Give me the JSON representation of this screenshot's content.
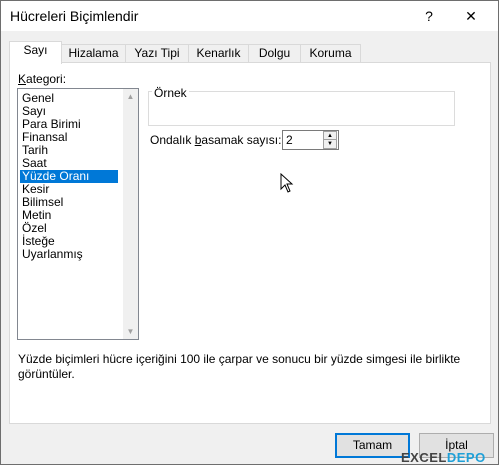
{
  "window": {
    "title": "Hücreleri Biçimlendir",
    "help_glyph": "?",
    "close_glyph": "✕"
  },
  "tabs": [
    {
      "label": "Sayı"
    },
    {
      "label": "Hizalama"
    },
    {
      "label": "Yazı Tipi"
    },
    {
      "label": "Kenarlık"
    },
    {
      "label": "Dolgu"
    },
    {
      "label": "Koruma"
    }
  ],
  "category": {
    "label_accel": "K",
    "label_rest": "ategori:",
    "items": [
      "Genel",
      "Sayı",
      "Para Birimi",
      "Finansal",
      "Tarih",
      "Saat",
      "Yüzde Oranı",
      "Kesir",
      "Bilimsel",
      "Metin",
      "Özel",
      "İsteğe Uyarlanmış"
    ],
    "selected_index": 6
  },
  "sample": {
    "label": "Örnek",
    "value": ""
  },
  "decimal": {
    "label_before": "Ondalık ",
    "label_accel": "b",
    "label_after": "asamak sayısı:",
    "value": "2"
  },
  "description": "Yüzde biçimleri hücre içeriğini 100 ile çarpar ve sonucu bir yüzde simgesi ile birlikte görüntüler.",
  "buttons": {
    "ok": "Tamam",
    "cancel": "İptal"
  },
  "watermark": {
    "part1": "EXCEL",
    "part2": "DEPO"
  },
  "colors": {
    "selection": "#0078d7",
    "accent_watermark": "#1ea0d8"
  }
}
